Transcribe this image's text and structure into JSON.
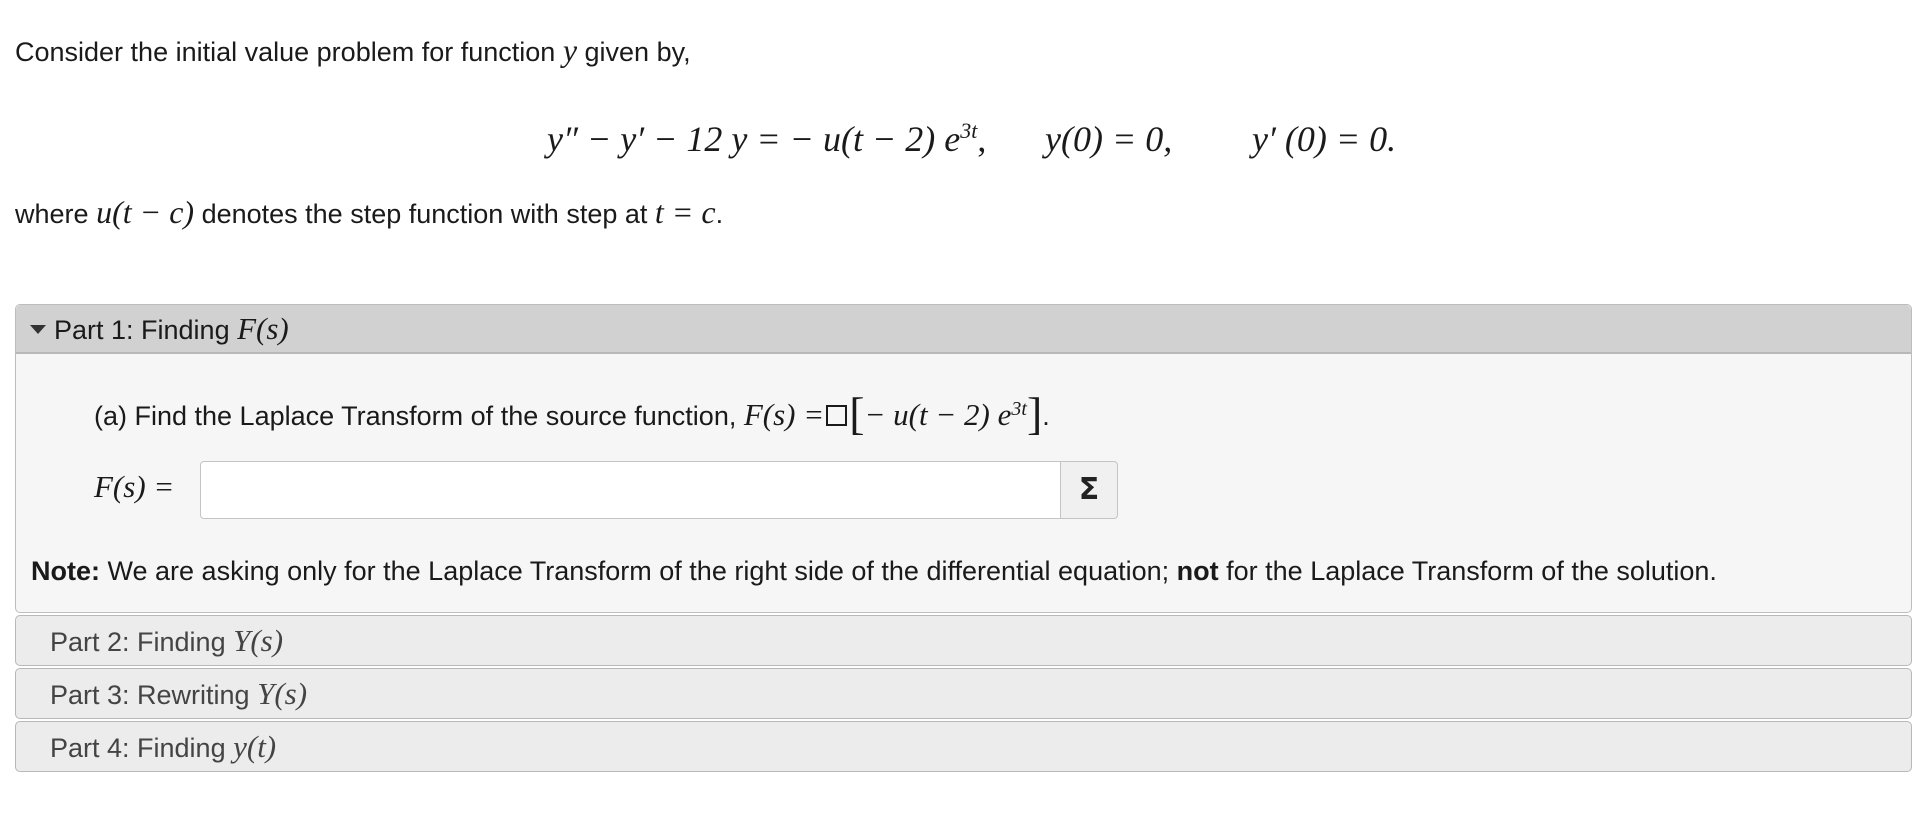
{
  "problem": {
    "intro_text": "Consider the initial value problem for function",
    "intro_var": "y",
    "intro_suffix": "given by,",
    "ode_lhs": "y″ − y′ − 12 y = − u(t − 2) e",
    "ode_exp": "3t",
    "ode_comma": ",",
    "ic1": "y(0) = 0,",
    "ic2": "y′ (0) = 0.",
    "where_prefix": "where",
    "where_func": "u(t − c)",
    "where_mid": "denotes the step function with step at",
    "where_eq": "t = c",
    "where_period": "."
  },
  "parts": [
    {
      "label": "Part 1: Finding",
      "math": "F(s)",
      "expanded": true
    },
    {
      "label": "Part 2: Finding",
      "math": "Y(s)",
      "expanded": false
    },
    {
      "label": "Part 3: Rewriting",
      "math": "Y(s)",
      "expanded": false
    },
    {
      "label": "Part 4: Finding",
      "math": "y(t)",
      "expanded": false
    }
  ],
  "part1": {
    "question_text": "(a) Find the Laplace Transform of the source function,",
    "question_lhs": "F(s) =",
    "question_inner": "− u(t − 2) e",
    "question_exp": "3t",
    "question_end": ".",
    "answer_label": "F(s) =",
    "answer_value": "",
    "answer_placeholder": "",
    "sigma_label": "Σ",
    "note_bold": "Note:",
    "note_text1": "We are asking only for the Laplace Transform of the right side of the differential equation;",
    "note_bold2": "not",
    "note_text2": "for the Laplace Transform of the solution."
  }
}
